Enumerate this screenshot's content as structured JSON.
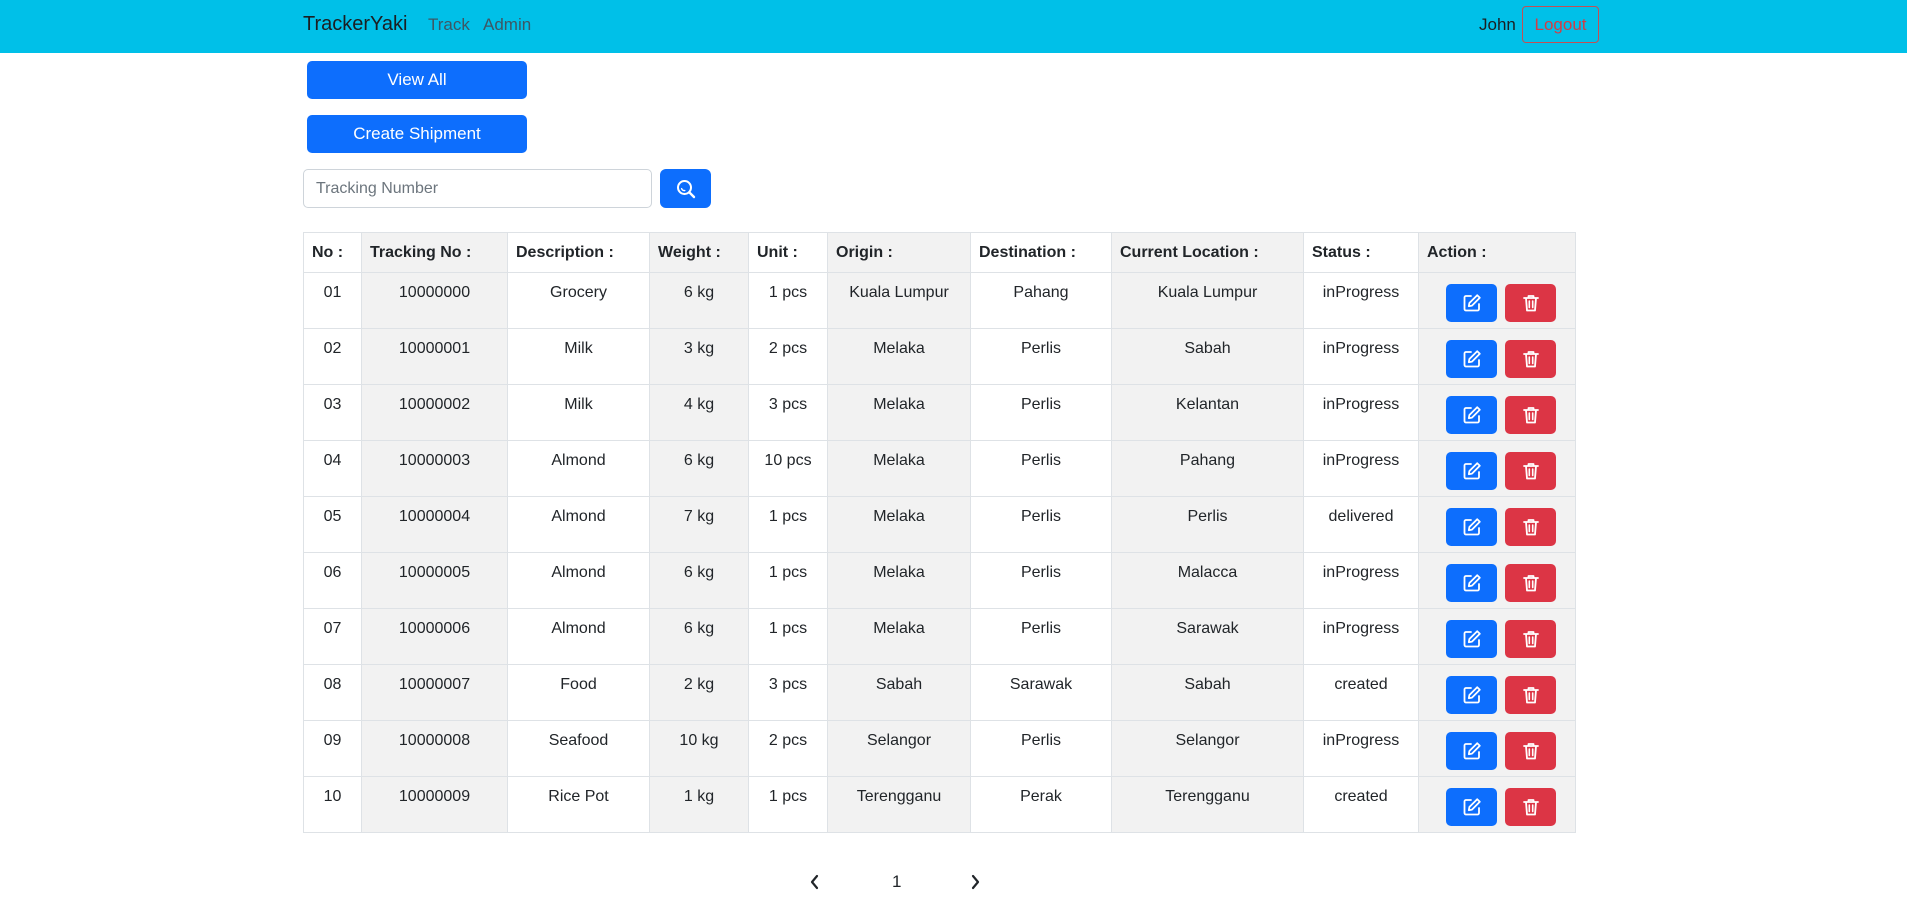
{
  "navbar": {
    "brand": "TrackerYaki",
    "links": [
      "Track",
      "Admin"
    ],
    "user_name": "John",
    "logout_label": "Logout",
    "background": "#00c0e8"
  },
  "actions": {
    "view_all_label": "View All",
    "create_shipment_label": "Create Shipment"
  },
  "search": {
    "placeholder": "Tracking Number",
    "value": "",
    "button_icon": "search-icon"
  },
  "table": {
    "headers": [
      "No :",
      "Tracking No :",
      "Description :",
      "Weight :",
      "Unit :",
      "Origin :",
      "Destination :",
      "Current Location :",
      "Status :",
      "Action :"
    ],
    "rows": [
      [
        "01",
        "10000000",
        "Grocery",
        "6 kg",
        "1 pcs",
        "Kuala Lumpur",
        "Pahang",
        "Kuala Lumpur",
        "inProgress"
      ],
      [
        "02",
        "10000001",
        "Milk",
        "3 kg",
        "2 pcs",
        "Melaka",
        "Perlis",
        "Sabah",
        "inProgress"
      ],
      [
        "03",
        "10000002",
        "Milk",
        "4 kg",
        "3 pcs",
        "Melaka",
        "Perlis",
        "Kelantan",
        "inProgress"
      ],
      [
        "04",
        "10000003",
        "Almond",
        "6 kg",
        "10 pcs",
        "Melaka",
        "Perlis",
        "Pahang",
        "inProgress"
      ],
      [
        "05",
        "10000004",
        "Almond",
        "7 kg",
        "1 pcs",
        "Melaka",
        "Perlis",
        "Perlis",
        "delivered"
      ],
      [
        "06",
        "10000005",
        "Almond",
        "6 kg",
        "1 pcs",
        "Melaka",
        "Perlis",
        "Malacca",
        "inProgress"
      ],
      [
        "07",
        "10000006",
        "Almond",
        "6 kg",
        "1 pcs",
        "Melaka",
        "Perlis",
        "Sarawak",
        "inProgress"
      ],
      [
        "08",
        "10000007",
        "Food",
        "2 kg",
        "3 pcs",
        "Sabah",
        "Sarawak",
        "Sabah",
        "created"
      ],
      [
        "09",
        "10000008",
        "Seafood",
        "10 kg",
        "2 pcs",
        "Selangor",
        "Perlis",
        "Selangor",
        "inProgress"
      ],
      [
        "10",
        "10000009",
        "Rice Pot",
        "1 kg",
        "1 pcs",
        "Terengganu",
        "Perak",
        "Terengganu",
        "created"
      ]
    ],
    "row_actions": [
      "edit-icon",
      "trash-icon"
    ]
  },
  "pagination": {
    "current_page": "1",
    "prev_icon": "chevron-left-icon",
    "next_icon": "chevron-right-icon"
  },
  "colors": {
    "primary": "#0d6efd",
    "danger": "#dc3545",
    "shaded_column": "#f2f2f2"
  }
}
